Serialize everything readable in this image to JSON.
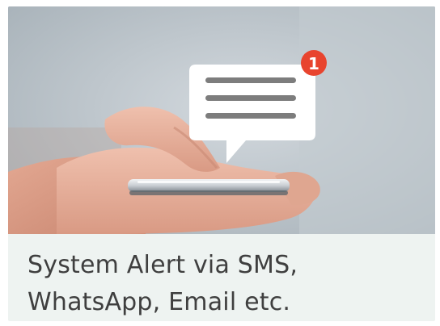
{
  "card": {
    "notification_count": "1",
    "caption_line1": "System Alert via SMS,",
    "caption_line2": "WhatsApp, Email etc."
  },
  "colors": {
    "caption_bg": "#eef3f1",
    "caption_text": "#3f3f3f",
    "badge": "#e8442e",
    "bubble": "#ffffff",
    "bubble_lines": "#7d7d7d"
  },
  "icons": [
    "chat-bubble-icon",
    "notification-badge-icon",
    "smartphone-icon"
  ]
}
